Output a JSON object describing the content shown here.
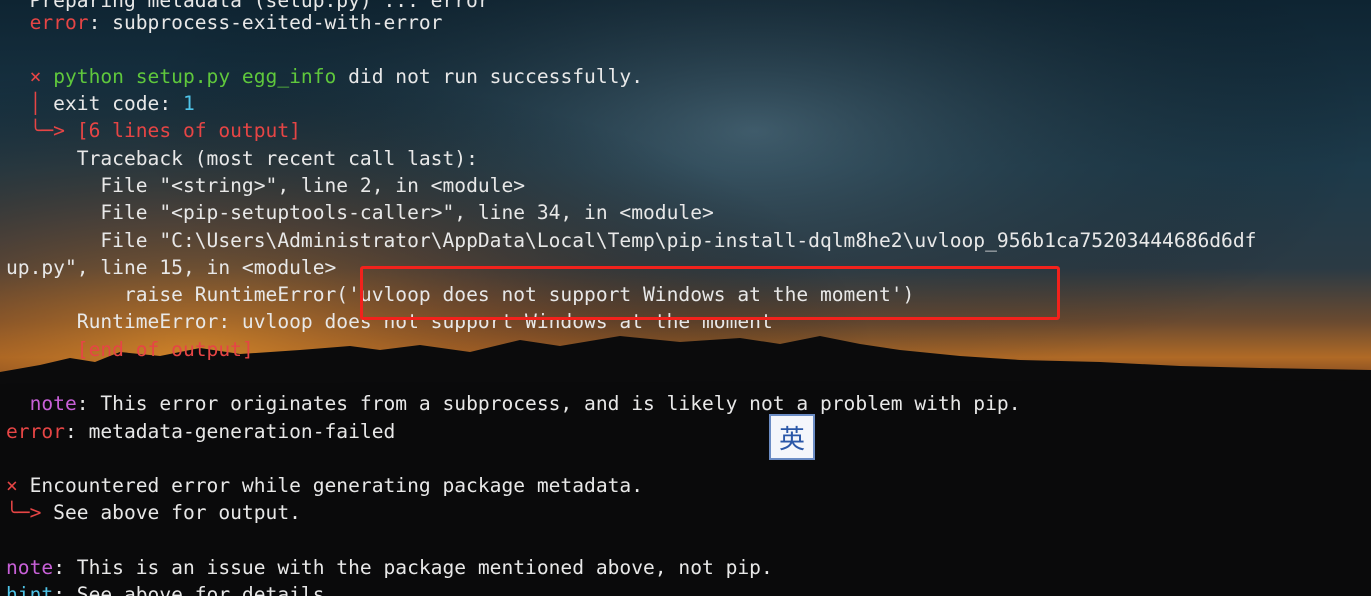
{
  "colors": {
    "error_red": "#e64545",
    "command_green": "#5fc83c",
    "note_magenta": "#c860d8",
    "hint_cyan": "#4fc4e8",
    "highlight_box": "#f2221c"
  },
  "terminal": {
    "l0": "Preparing metadata (setup.py) ... error",
    "l1_kw": "error",
    "l1_rest": ": subprocess-exited-with-error",
    "l3_mark": "×",
    "l3_cmd": "python setup.py egg_info",
    "l3_rest": " did not run successfully.",
    "l4_pipe": "│",
    "l4_text": " exit code: ",
    "l4_code": "1",
    "l5_arrow": "╰─>",
    "l5_text": " [6 lines of output]",
    "l6": "Traceback (most recent call last):",
    "l7": "File \"<string>\", line 2, in <module>",
    "l8": "File \"<pip-setuptools-caller>\", line 34, in <module>",
    "l9": "File \"C:\\Users\\Administrator\\AppData\\Local\\Temp\\pip-install-dqlm8he2\\uvloop_956b1ca75203444686d6df",
    "l10": "up.py\", line 15, in <module>",
    "l11": "raise RuntimeError('uvloop does not support Windows at the moment')",
    "l12": "RuntimeError: uvloop does not support Windows at the moment",
    "l13": "[end of output]",
    "l15_kw": "note",
    "l15_rest": ": This error originates from a subprocess, and is likely not a problem with pip.",
    "l16_kw": "error",
    "l16_rest": ": metadata-generation-failed",
    "l18_mark": "×",
    "l18_rest": " Encountered error while generating package metadata.",
    "l19_arrow": "╰─>",
    "l19_rest": " See above for output.",
    "l21_kw": "note",
    "l21_rest": ": This is an issue with the package mentioned above, not pip.",
    "l22_kw": "hint",
    "l22_rest": ": See above for details."
  },
  "ime_indicator": "英"
}
